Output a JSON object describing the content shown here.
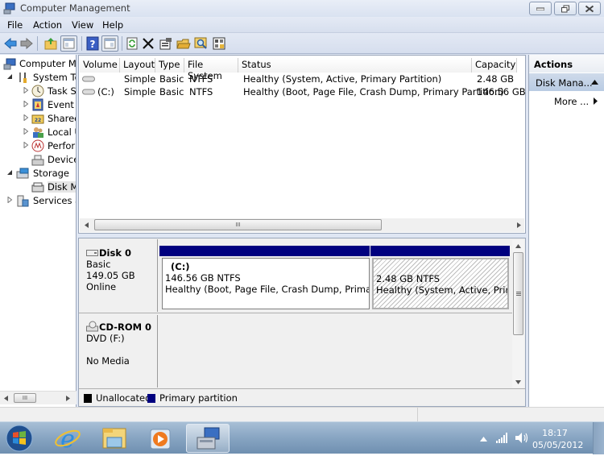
{
  "window": {
    "title": "Computer Management",
    "controls": {
      "minimize": "minimize",
      "restore": "restore",
      "close": "close"
    }
  },
  "menu": [
    "File",
    "Action",
    "View",
    "Help"
  ],
  "toolbar": {
    "icons": [
      "back-arrow",
      "forward-arrow",
      "up-folder",
      "show-hide-console-tree",
      "help",
      "show-hide-action-pane",
      "refresh",
      "delete",
      "properties",
      "open",
      "search",
      "settings"
    ]
  },
  "tree": {
    "items": [
      {
        "label": "Computer Management (Local)",
        "display": "Computer Ma",
        "icon": "computer-management-icon",
        "expander": ""
      },
      {
        "label": "System Tools",
        "display": "System To",
        "icon": "tools-icon",
        "expander": "expanded"
      },
      {
        "label": "Task Scheduler",
        "display": "Task S",
        "icon": "clock-icon",
        "expander": "collapsed"
      },
      {
        "label": "Event Viewer",
        "display": "Event V",
        "icon": "event-viewer-icon",
        "expander": "collapsed"
      },
      {
        "label": "Shared Folders",
        "display": "Sharec",
        "icon": "shared-folder-icon",
        "expander": "collapsed"
      },
      {
        "label": "Local Users and Groups",
        "display": "Local U",
        "icon": "users-icon",
        "expander": "collapsed"
      },
      {
        "label": "Performance",
        "display": "Perforn",
        "icon": "performance-icon",
        "expander": "collapsed"
      },
      {
        "label": "Device Manager",
        "display": "Device",
        "icon": "device-manager-icon",
        "expander": ""
      },
      {
        "label": "Storage",
        "display": "Storage",
        "icon": "storage-icon",
        "expander": "expanded"
      },
      {
        "label": "Disk Management",
        "display": "Disk M",
        "icon": "disk-icon",
        "expander": "",
        "selected": true
      },
      {
        "label": "Services and Applications",
        "display": "Services ar",
        "icon": "services-icon",
        "expander": "collapsed"
      }
    ]
  },
  "volumes": {
    "columns": [
      "Volume",
      "Layout",
      "Type",
      "File System",
      "Status",
      "Capacity"
    ],
    "rows": [
      {
        "volume": "",
        "layout": "Simple",
        "type": "Basic",
        "fs": "NTFS",
        "status": "Healthy (System, Active, Primary Partition)",
        "capacity": "2.48 GB"
      },
      {
        "volume": "(C:)",
        "layout": "Simple",
        "type": "Basic",
        "fs": "NTFS",
        "status": "Healthy (Boot, Page File, Crash Dump, Primary Partition)",
        "capacity": "146.56 GB"
      }
    ]
  },
  "disks": [
    {
      "name": "Disk 0",
      "type": "Basic",
      "size": "149.05 GB",
      "state": "Online",
      "partitions": [
        {
          "letter": "(C:)",
          "size": "146.56 GB NTFS",
          "status": "Healthy (Boot, Page File, Crash Dump, Primary Par"
        },
        {
          "letter": "",
          "size": "2.48 GB NTFS",
          "status": "Healthy (System, Active, Primary"
        }
      ]
    },
    {
      "name": "CD-ROM 0",
      "type": "DVD (F:)",
      "state": "No Media"
    }
  ],
  "legend": [
    {
      "label": "Unallocated",
      "color": "#000000"
    },
    {
      "label": "Primary partition",
      "color": "#00007f"
    }
  ],
  "actions": {
    "title": "Actions",
    "section": "Disk Mana...",
    "more": "More ..."
  },
  "taskbar": {
    "apps": [
      "start-button",
      "internet-explorer",
      "windows-explorer",
      "media-player",
      "computer-management"
    ],
    "time": "18:17",
    "date": "05/05/2012"
  },
  "scroll_glyph": "III"
}
